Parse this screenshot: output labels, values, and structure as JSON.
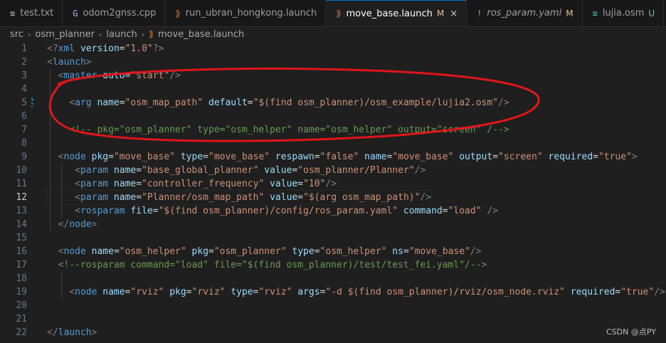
{
  "tabs": [
    {
      "label": "test.txt",
      "icon": "≡",
      "icon_name": "text-file-icon",
      "icon_color": "#c5c5c5",
      "modified": "",
      "active": false,
      "italic": false
    },
    {
      "label": "odom2gnss.cpp",
      "icon": "G",
      "icon_name": "cpp-file-icon",
      "icon_color": "#9cc0e6",
      "modified": "",
      "active": false,
      "italic": false
    },
    {
      "label": "run_ubran_hongkong.launch",
      "icon": "⟫",
      "icon_name": "launch-file-icon",
      "icon_color": "#e37933",
      "modified": "",
      "active": false,
      "italic": false
    },
    {
      "label": "move_base.launch",
      "icon": "⟫",
      "icon_name": "launch-file-icon",
      "icon_color": "#e37933",
      "modified": "M",
      "active": true,
      "italic": false
    },
    {
      "label": "ros_param.yaml",
      "icon": "!",
      "icon_name": "yaml-file-icon",
      "icon_color": "#c586c0",
      "modified": "M",
      "active": false,
      "italic": true
    },
    {
      "label": "lujia.osm",
      "icon": "≡",
      "icon_name": "osm-file-icon",
      "icon_color": "#4ec9b0",
      "modified": "U",
      "active": false,
      "italic": false
    }
  ],
  "close_glyph": "×",
  "breadcrumb": {
    "items": [
      "src",
      "osm_planner",
      "launch",
      "move_base.launch"
    ],
    "separator": "›",
    "file_icon": "⟫"
  },
  "editor": {
    "current_line": 12,
    "modified_line": 5,
    "lines": [
      {
        "n": "1",
        "tokens": [
          {
            "t": "<?",
            "c": "p"
          },
          {
            "t": "xml",
            "c": "t"
          },
          {
            "t": " version",
            "c": "a"
          },
          {
            "t": "=",
            "c": "x"
          },
          {
            "t": "\"1.0\"",
            "c": "s"
          },
          {
            "t": "?>",
            "c": "p"
          }
        ]
      },
      {
        "n": "2",
        "tokens": [
          {
            "t": "<",
            "c": "p"
          },
          {
            "t": "launch",
            "c": "t"
          },
          {
            "t": ">",
            "c": "p"
          }
        ]
      },
      {
        "n": "3",
        "tokens": [
          {
            "t": "  "
          },
          {
            "t": "<",
            "c": "p"
          },
          {
            "t": "master",
            "c": "t"
          },
          {
            "t": " auto",
            "c": "a"
          },
          {
            "t": "=",
            "c": "x"
          },
          {
            "t": "\"start\"",
            "c": "s"
          },
          {
            "t": "/>",
            "c": "p"
          }
        ]
      },
      {
        "n": "4",
        "tokens": []
      },
      {
        "n": "5",
        "tokens": [
          {
            "t": "    "
          },
          {
            "t": "<",
            "c": "p"
          },
          {
            "t": "arg",
            "c": "t"
          },
          {
            "t": " name",
            "c": "a"
          },
          {
            "t": "=",
            "c": "x"
          },
          {
            "t": "\"osm_map_path\"",
            "c": "s"
          },
          {
            "t": " default",
            "c": "a"
          },
          {
            "t": "=",
            "c": "x"
          },
          {
            "t": "\"$(find osm_planner)/osm_example/lujia2.osm\"",
            "c": "s"
          },
          {
            "t": "/>",
            "c": "p"
          }
        ]
      },
      {
        "n": "6",
        "tokens": []
      },
      {
        "n": "7",
        "tokens": [
          {
            "t": "    "
          },
          {
            "t": "<!-- pkg=\"osm_planner\" type=\"osm_helper\" name=\"osm_helper\" output=\"screen\" /-->",
            "c": "c"
          }
        ]
      },
      {
        "n": "8",
        "tokens": []
      },
      {
        "n": "9",
        "tokens": [
          {
            "t": "  "
          },
          {
            "t": "<",
            "c": "p"
          },
          {
            "t": "node",
            "c": "t"
          },
          {
            "t": " pkg",
            "c": "a"
          },
          {
            "t": "=",
            "c": "x"
          },
          {
            "t": "\"move_base\"",
            "c": "s"
          },
          {
            "t": " type",
            "c": "a"
          },
          {
            "t": "=",
            "c": "x"
          },
          {
            "t": "\"move_base\"",
            "c": "s"
          },
          {
            "t": " respawn",
            "c": "a"
          },
          {
            "t": "=",
            "c": "x"
          },
          {
            "t": "\"false\"",
            "c": "s"
          },
          {
            "t": " name",
            "c": "a"
          },
          {
            "t": "=",
            "c": "x"
          },
          {
            "t": "\"move_base\"",
            "c": "s"
          },
          {
            "t": " output",
            "c": "a"
          },
          {
            "t": "=",
            "c": "x"
          },
          {
            "t": "\"screen\"",
            "c": "s"
          },
          {
            "t": " required",
            "c": "a"
          },
          {
            "t": "=",
            "c": "x"
          },
          {
            "t": "\"true\"",
            "c": "s"
          },
          {
            "t": ">",
            "c": "p"
          }
        ]
      },
      {
        "n": "10",
        "tokens": [
          {
            "t": "     "
          },
          {
            "t": "<",
            "c": "p"
          },
          {
            "t": "param",
            "c": "t"
          },
          {
            "t": " name",
            "c": "a"
          },
          {
            "t": "=",
            "c": "x"
          },
          {
            "t": "\"base_global_planner\"",
            "c": "s"
          },
          {
            "t": " value",
            "c": "a"
          },
          {
            "t": "=",
            "c": "x"
          },
          {
            "t": "\"osm_planner/Planner\"",
            "c": "s"
          },
          {
            "t": "/>",
            "c": "p"
          }
        ]
      },
      {
        "n": "11",
        "tokens": [
          {
            "t": "     "
          },
          {
            "t": "<",
            "c": "p"
          },
          {
            "t": "param",
            "c": "t"
          },
          {
            "t": " name",
            "c": "a"
          },
          {
            "t": "=",
            "c": "x"
          },
          {
            "t": "\"controller_frequency\"",
            "c": "s"
          },
          {
            "t": " value",
            "c": "a"
          },
          {
            "t": "=",
            "c": "x"
          },
          {
            "t": "\"10\"",
            "c": "s"
          },
          {
            "t": "/>",
            "c": "p"
          }
        ]
      },
      {
        "n": "12",
        "tokens": [
          {
            "t": "     "
          },
          {
            "t": "<",
            "c": "p"
          },
          {
            "t": "param",
            "c": "t"
          },
          {
            "t": " name",
            "c": "a"
          },
          {
            "t": "=",
            "c": "x"
          },
          {
            "t": "\"Planner/osm_map_path\"",
            "c": "s"
          },
          {
            "t": " value",
            "c": "a"
          },
          {
            "t": "=",
            "c": "x"
          },
          {
            "t": "\"$(arg osm_map_path)\"",
            "c": "s"
          },
          {
            "t": "/>",
            "c": "p"
          }
        ]
      },
      {
        "n": "13",
        "tokens": [
          {
            "t": "     "
          },
          {
            "t": "<",
            "c": "p"
          },
          {
            "t": "rosparam",
            "c": "t"
          },
          {
            "t": " file",
            "c": "a"
          },
          {
            "t": "=",
            "c": "x"
          },
          {
            "t": "\"$(find osm_planner)/config/ros_param.yaml\"",
            "c": "s"
          },
          {
            "t": " command",
            "c": "a"
          },
          {
            "t": "=",
            "c": "x"
          },
          {
            "t": "\"load\"",
            "c": "s"
          },
          {
            "t": " />",
            "c": "p"
          }
        ]
      },
      {
        "n": "14",
        "tokens": [
          {
            "t": "  "
          },
          {
            "t": "</",
            "c": "p"
          },
          {
            "t": "node",
            "c": "t"
          },
          {
            "t": ">",
            "c": "p"
          }
        ]
      },
      {
        "n": "15",
        "tokens": []
      },
      {
        "n": "16",
        "tokens": [
          {
            "t": "  "
          },
          {
            "t": "<",
            "c": "p"
          },
          {
            "t": "node",
            "c": "t"
          },
          {
            "t": " name",
            "c": "a"
          },
          {
            "t": "=",
            "c": "x"
          },
          {
            "t": "\"osm_helper\"",
            "c": "s"
          },
          {
            "t": " pkg",
            "c": "a"
          },
          {
            "t": "=",
            "c": "x"
          },
          {
            "t": "\"osm_planner\"",
            "c": "s"
          },
          {
            "t": " type",
            "c": "a"
          },
          {
            "t": "=",
            "c": "x"
          },
          {
            "t": "\"osm_helper\"",
            "c": "s"
          },
          {
            "t": " ns",
            "c": "a"
          },
          {
            "t": "=",
            "c": "x"
          },
          {
            "t": "\"move_base\"",
            "c": "s"
          },
          {
            "t": "/>",
            "c": "p"
          }
        ]
      },
      {
        "n": "17",
        "tokens": [
          {
            "t": "  "
          },
          {
            "t": "<!--rosparam command=\"load\" file=\"$(find osm_planner)/test/test_fei.yaml\"/-->",
            "c": "c"
          }
        ]
      },
      {
        "n": "18",
        "tokens": []
      },
      {
        "n": "19",
        "tokens": [
          {
            "t": "    "
          },
          {
            "t": "<",
            "c": "p"
          },
          {
            "t": "node",
            "c": "t"
          },
          {
            "t": " name",
            "c": "a"
          },
          {
            "t": "=",
            "c": "x"
          },
          {
            "t": "\"rviz\"",
            "c": "s"
          },
          {
            "t": " pkg",
            "c": "a"
          },
          {
            "t": "=",
            "c": "x"
          },
          {
            "t": "\"rviz\"",
            "c": "s"
          },
          {
            "t": " type",
            "c": "a"
          },
          {
            "t": "=",
            "c": "x"
          },
          {
            "t": "\"rviz\"",
            "c": "s"
          },
          {
            "t": " args",
            "c": "a"
          },
          {
            "t": "=",
            "c": "x"
          },
          {
            "t": "\"-d $(find osm_planner)/rviz/osm_node.rviz\"",
            "c": "s"
          },
          {
            "t": " required",
            "c": "a"
          },
          {
            "t": "=",
            "c": "x"
          },
          {
            "t": "\"true\"",
            "c": "s"
          },
          {
            "t": "/>",
            "c": "p"
          }
        ]
      },
      {
        "n": "20",
        "tokens": []
      },
      {
        "n": "21",
        "tokens": []
      },
      {
        "n": "22",
        "tokens": [
          {
            "t": "</",
            "c": "p"
          },
          {
            "t": "launch",
            "c": "t"
          },
          {
            "t": ">",
            "c": "p"
          }
        ]
      }
    ]
  },
  "colors": {
    "tag": "#569cd6",
    "attr": "#9cdcfe",
    "string": "#ce9178",
    "punct": "#808080",
    "comment": "#6a9955",
    "annotation": "#e0161b",
    "accent": "#0078d4"
  },
  "watermark": "CSDN @点PY"
}
